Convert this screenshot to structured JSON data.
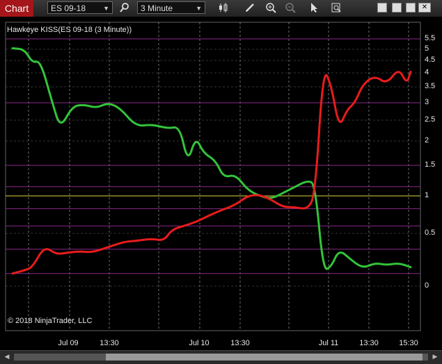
{
  "toolbar": {
    "tab_label": "Chart",
    "instrument": "ES 09-18",
    "interval": "3 Minute",
    "icons": [
      "search-icon",
      "candlestick-icon",
      "pencil-icon",
      "zoom-in-icon",
      "zoom-out-icon",
      "pointer-icon",
      "data-box-icon"
    ],
    "window_buttons": [
      "restore",
      "minimize",
      "maximize",
      "close"
    ]
  },
  "indicator_label": "Hawkeye KISS(ES 09-18 (3 Minute))",
  "copyright": "© 2018 NinjaTrader, LLC",
  "colors": {
    "green_line": "#33c43a",
    "red_line": "#e81c1c",
    "yellow_line": "#e0d840",
    "purple_lines": "#8a2a8a",
    "grid": "#888888"
  },
  "chart_data": {
    "type": "line",
    "x_tick_labels": [
      "Jul 09",
      "13:30",
      "Jul 10",
      "13:30",
      "Jul 11",
      "13:30",
      "15:30"
    ],
    "y_tick_labels": [
      "5.5",
      "5",
      "4.5",
      "4",
      "3.5",
      "3",
      "2.5",
      "2",
      "1.5",
      "1",
      "0.5",
      "0"
    ],
    "reference_levels": [
      {
        "value": 1,
        "color": "yellow"
      },
      {
        "value": 1.5,
        "color": "purple"
      },
      {
        "value": 3,
        "color": "purple"
      },
      {
        "value": 5.5,
        "color": "purple"
      },
      {
        "value": 0.35,
        "color": "purple"
      },
      {
        "value": 0.12,
        "color": "purple"
      },
      {
        "value": 0.83,
        "color": "purple"
      },
      {
        "value": 1.15,
        "color": "purple"
      },
      {
        "value": 0.6,
        "color": "purple"
      }
    ],
    "series": [
      {
        "color": "green",
        "points": [
          [
            0,
            5.05
          ],
          [
            3,
            5.0
          ],
          [
            5,
            4.4
          ],
          [
            7,
            4.5
          ],
          [
            10,
            3.0
          ],
          [
            12,
            2.3
          ],
          [
            15,
            2.9
          ],
          [
            18,
            2.95
          ],
          [
            21,
            2.85
          ],
          [
            24,
            3.0
          ],
          [
            27,
            2.85
          ],
          [
            31,
            2.35
          ],
          [
            35,
            2.4
          ],
          [
            39,
            2.3
          ],
          [
            42,
            2.35
          ],
          [
            44,
            1.55
          ],
          [
            46,
            2.1
          ],
          [
            48,
            1.75
          ],
          [
            51,
            1.6
          ],
          [
            53,
            1.3
          ],
          [
            56,
            1.35
          ],
          [
            59,
            1.1
          ],
          [
            62,
            1.0
          ],
          [
            65,
            0.96
          ],
          [
            68,
            1.05
          ],
          [
            71,
            1.15
          ],
          [
            74,
            1.25
          ],
          [
            76,
            1.2
          ],
          [
            78,
            0.15
          ],
          [
            80,
            0.18
          ],
          [
            82,
            0.35
          ],
          [
            85,
            0.25
          ],
          [
            88,
            0.17
          ],
          [
            91,
            0.22
          ],
          [
            94,
            0.2
          ],
          [
            97,
            0.22
          ],
          [
            100,
            0.18
          ]
        ]
      },
      {
        "color": "red",
        "points": [
          [
            0,
            0.12
          ],
          [
            3,
            0.15
          ],
          [
            5,
            0.18
          ],
          [
            8,
            0.38
          ],
          [
            11,
            0.3
          ],
          [
            14,
            0.32
          ],
          [
            17,
            0.33
          ],
          [
            20,
            0.32
          ],
          [
            24,
            0.37
          ],
          [
            28,
            0.42
          ],
          [
            31,
            0.43
          ],
          [
            35,
            0.45
          ],
          [
            38,
            0.43
          ],
          [
            40,
            0.55
          ],
          [
            43,
            0.6
          ],
          [
            46,
            0.65
          ],
          [
            49,
            0.73
          ],
          [
            52,
            0.8
          ],
          [
            56,
            0.88
          ],
          [
            59,
            1.0
          ],
          [
            62,
            1.02
          ],
          [
            65,
            0.95
          ],
          [
            68,
            0.85
          ],
          [
            71,
            0.85
          ],
          [
            74,
            0.82
          ],
          [
            76,
            1.0
          ],
          [
            78,
            4.2
          ],
          [
            80,
            3.6
          ],
          [
            82,
            2.3
          ],
          [
            84,
            2.8
          ],
          [
            86,
            3.0
          ],
          [
            88,
            3.6
          ],
          [
            91,
            3.9
          ],
          [
            94,
            3.6
          ],
          [
            97,
            4.2
          ],
          [
            99,
            3.6
          ],
          [
            100,
            4.05
          ]
        ]
      }
    ]
  }
}
